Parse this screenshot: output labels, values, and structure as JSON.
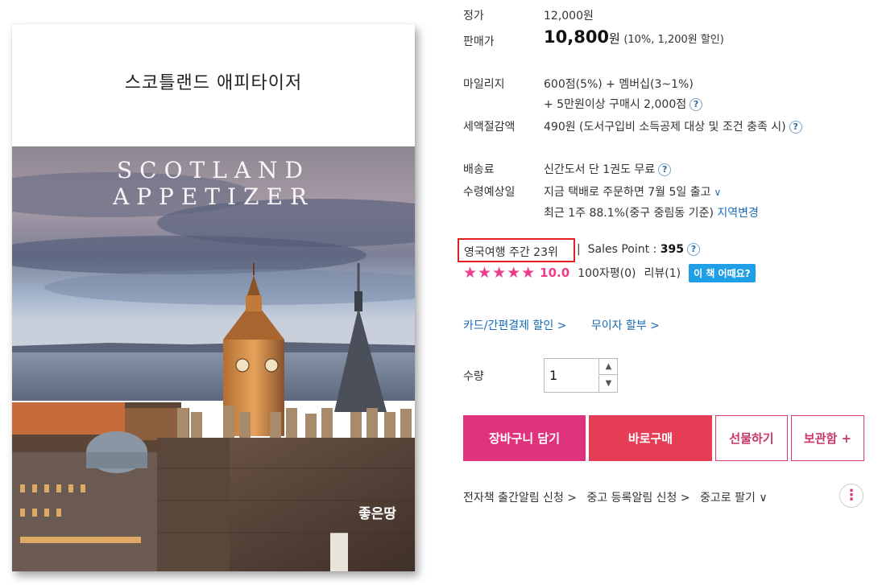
{
  "cover": {
    "title_ko": "스코틀랜드 애피타이저",
    "title_en": "SCOTLAND APPETIZER",
    "publisher": "좋은땅"
  },
  "price": {
    "list_label": "정가",
    "list_value": "12,000원",
    "sale_label": "판매가",
    "sale_amount": "10,800",
    "sale_unit": "원",
    "sale_discount": "(10%, 1,200원 할인)"
  },
  "mileage": {
    "label": "마일리지",
    "line1": "600점(5%) + 멤버십(3~1%)",
    "line2": "+ 5만원이상 구매시 2,000점"
  },
  "tax": {
    "label": "세액절감액",
    "value": "490원 (도서구입비 소득공제 대상 및 조건 충족 시)"
  },
  "shipping": {
    "fee_label": "배송료",
    "fee_value": "신간도서 단 1권도 무료",
    "eta_label": "수령예상일",
    "eta_value": "지금 택배로 주문하면 7월 5일 출고",
    "eta_sub": "최근 1주 88.1%(중구 중림동 기준)",
    "region_link": "지역변경"
  },
  "ranking": {
    "rank_text": "영국여행 주간 23위",
    "separator": "|",
    "sales_label": "Sales Point :",
    "sales_value": "395",
    "stars": "★★★★★",
    "score": "10.0",
    "reviews_100": "100자평(0)",
    "reviews": "리뷰(1)",
    "howabout_button": "이 책 어때요?"
  },
  "payment_links": {
    "card": "카드/간편결제 할인 >",
    "installment": "무이자 할부 >"
  },
  "quantity": {
    "label": "수량",
    "value": "1"
  },
  "buttons": {
    "cart": "장바구니 담기",
    "buy": "바로구매",
    "gift": "선물하기",
    "keep": "보관함 +"
  },
  "bottom_links": {
    "ebook_alert": "전자책 출간알림 신청 >",
    "used_alert": "중고 등록알림 신청 >",
    "sell_used": "중고로 팔기 ∨"
  },
  "icons": {
    "help": "?",
    "chevron_down": "∨",
    "up": "▲",
    "down": "▼",
    "more": "⋮"
  },
  "colors": {
    "accent_pink": "#e0337e",
    "buy_red": "#e53d56",
    "link_blue": "#1a6bb8",
    "rank_border": "#e22020",
    "badge_blue": "#1fa0e6"
  }
}
